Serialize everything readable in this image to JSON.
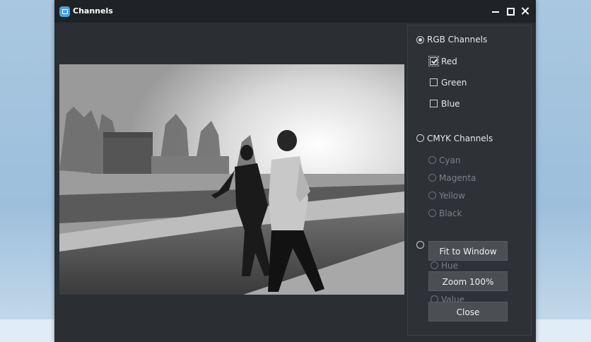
{
  "window": {
    "title": "Channels",
    "app_icon": "channels-app-icon"
  },
  "title_controls": [
    "minimize-icon",
    "maximize-icon",
    "close-icon"
  ],
  "image": {
    "description_icon": "photo-preview",
    "mode": "grayscale"
  },
  "panel": {
    "rgb": {
      "label": "RGB Channels",
      "selected": true,
      "channels": [
        {
          "label": "Red",
          "checked": true
        },
        {
          "label": "Green",
          "checked": false
        },
        {
          "label": "Blue",
          "checked": false
        }
      ]
    },
    "cmyk": {
      "label": "CMYK Channels",
      "selected": false,
      "channels": [
        {
          "label": "Cyan"
        },
        {
          "label": "Magenta"
        },
        {
          "label": "Yellow"
        },
        {
          "label": "Black"
        }
      ]
    },
    "hsv": {
      "selected": false,
      "channels": [
        {
          "label": "Hue"
        },
        {
          "label": "Value"
        }
      ]
    }
  },
  "buttons": {
    "fit": "Fit to Window",
    "zoom": "Zoom 100%",
    "close": "Close"
  },
  "colors": {
    "window_bg": "#2b2e33",
    "titlebar": "#1f2226",
    "button_bg": "#4b4f54",
    "desktop": "#a9c7e0"
  }
}
